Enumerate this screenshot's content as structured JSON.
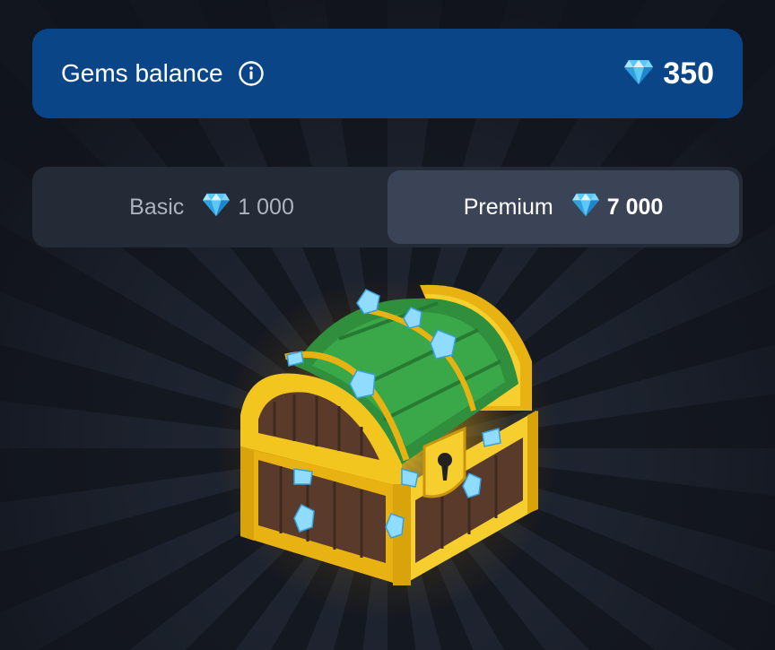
{
  "balance": {
    "label": "Gems balance",
    "value": "350",
    "info_icon": "info-icon",
    "gem_icon": "diamond-icon"
  },
  "tabs": [
    {
      "name": "Basic",
      "price": "1 000",
      "selected": false
    },
    {
      "name": "Premium",
      "price": "7 000",
      "selected": true
    }
  ],
  "colors": {
    "balance_bar": "#0a4687",
    "tab_selected": "#3a4456",
    "tab_bar": "#252b36",
    "background": "#141821"
  },
  "illustration": {
    "icon": "treasure-chest-icon"
  }
}
